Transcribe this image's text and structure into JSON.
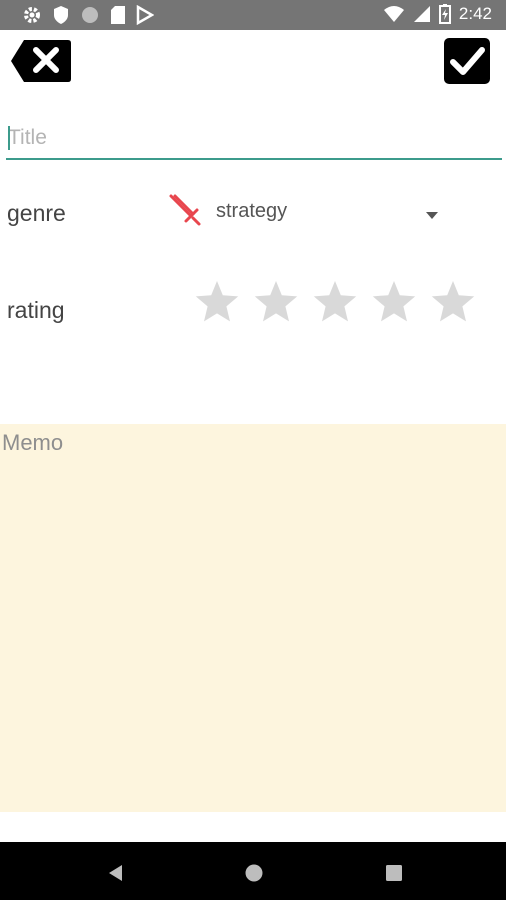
{
  "status_bar": {
    "time": "2:42",
    "left_icons": [
      "settings-icon",
      "shield-icon",
      "circle-icon",
      "sd-card-icon",
      "play-store-icon"
    ],
    "right_icons": [
      "wifi-icon",
      "signal-icon",
      "battery-icon"
    ]
  },
  "toolbar": {
    "cancel_icon": "close-icon",
    "confirm_icon": "check-icon"
  },
  "form": {
    "title": {
      "value": "",
      "placeholder": "Title"
    },
    "genre": {
      "label": "genre",
      "selected": "strategy",
      "icon": "sword-icon",
      "icon_color": "#e8464e"
    },
    "rating": {
      "label": "rating",
      "value": 0,
      "max": 5
    },
    "memo": {
      "value": "",
      "placeholder": "Memo"
    }
  },
  "colors": {
    "accent": "#3c9b8c",
    "memo_background": "#fdf5de",
    "star_empty": "#d9d9d9"
  },
  "nav_bar": {
    "buttons": [
      "back-icon",
      "home-icon",
      "recents-icon"
    ]
  }
}
